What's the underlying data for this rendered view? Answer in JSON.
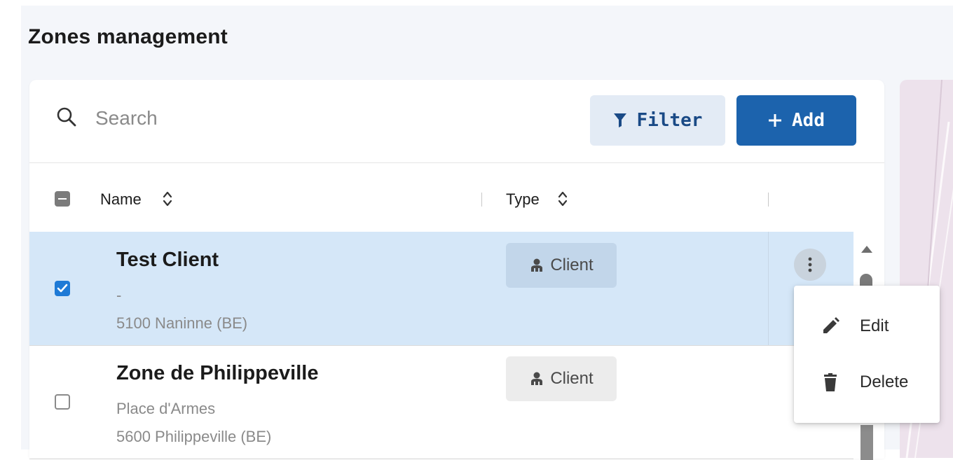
{
  "page": {
    "title": "Zones management"
  },
  "toolbar": {
    "search_placeholder": "Search",
    "search_value": "",
    "filter_label": "Filter",
    "add_label": "Add"
  },
  "table": {
    "columns": [
      {
        "label": "Name"
      },
      {
        "label": "Type"
      }
    ],
    "rows": [
      {
        "name": "Test Client",
        "line2": "-",
        "line3": "5100 Naninne (BE)",
        "type": "Client",
        "selected": true
      },
      {
        "name": "Zone de Philippeville",
        "line2": "Place d'Armes",
        "line3": "5600 Philippeville (BE)",
        "type": "Client",
        "selected": false
      }
    ]
  },
  "context_menu": {
    "items": [
      {
        "label": "Edit",
        "icon": "pencil-icon"
      },
      {
        "label": "Delete",
        "icon": "trash-icon"
      }
    ]
  },
  "colors": {
    "primary": "#1c63ad",
    "filter_bg": "#e3ebf5",
    "selected_row": "#d5e7f8",
    "checkbox_checked": "#1e7ad6",
    "page_bg": "#f4f6fa"
  }
}
